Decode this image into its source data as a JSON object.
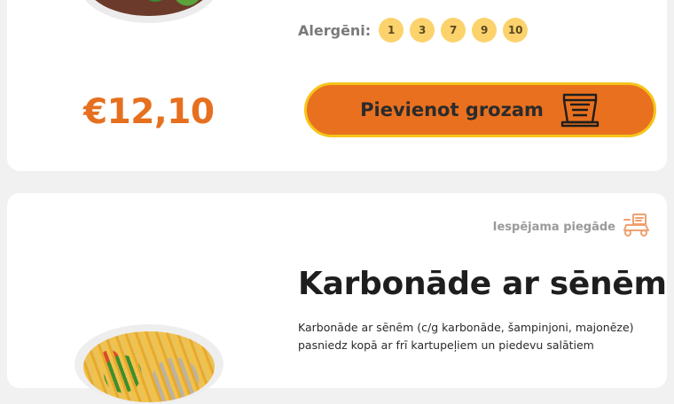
{
  "products": [
    {
      "allergens_label": "Alergēni:",
      "allergens": [
        "1",
        "3",
        "7",
        "9",
        "10"
      ],
      "price": "€12,10",
      "add_to_cart_label": "Pievienot grozam",
      "image_icon": "food-plate-image",
      "cart_icon": "cart-box-icon"
    },
    {
      "delivery_label": "Iespējama piegāde",
      "delivery_icon": "delivery-scooter-icon",
      "title": "Karbonāde ar sēnēm",
      "description": "Karbonāde ar sēnēm (c/g karbonāde, šampinjoni, majonēze) pasniedz kopā ar frī kartupeļiem un piedevu salātiem",
      "image_icon": "food-plate-image"
    }
  ],
  "colors": {
    "accent_orange": "#e8701f",
    "button_border": "#f6c419",
    "allergen_badge": "#fcd26c",
    "price": "#e6701f"
  }
}
